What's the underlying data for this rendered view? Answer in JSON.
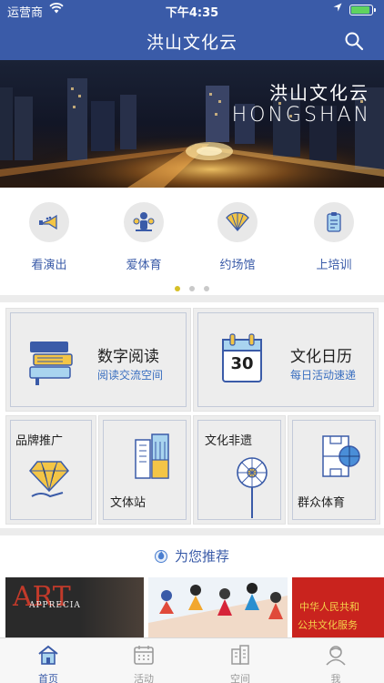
{
  "status_bar": {
    "carrier": "运营商",
    "time": "下午4:35"
  },
  "nav": {
    "title": "洪山文化云"
  },
  "banner": {
    "title_cn": "洪山文化云",
    "title_en": "HONGSHAN"
  },
  "quick_entries": [
    {
      "label": "看演出",
      "icon": "trumpet-icon"
    },
    {
      "label": "爱体育",
      "icon": "sports-icon"
    },
    {
      "label": "约场馆",
      "icon": "fan-icon"
    },
    {
      "label": "上培训",
      "icon": "clipboard-icon"
    }
  ],
  "pager": {
    "pages": 3,
    "active": 0
  },
  "features": {
    "reading": {
      "title": "数字阅读",
      "subtitle": "阅读交流空间"
    },
    "calendar": {
      "title": "文化日历",
      "subtitle": "每日活动速递",
      "day": "30"
    },
    "brand": {
      "title": "品牌推广"
    },
    "station": {
      "title": "文体站"
    },
    "heritage": {
      "title": "文化非遗"
    },
    "sports": {
      "title": "群众体育"
    }
  },
  "recommend": {
    "title": "为您推荐",
    "cards": [
      {
        "text_a": "ART",
        "text_b": "APPRECIATION"
      },
      {
        "text_a": ""
      },
      {
        "text_a": "中华人民共和",
        "text_b": "公共文化服务"
      }
    ]
  },
  "tabs": [
    {
      "label": "首页",
      "icon": "home-icon",
      "active": true
    },
    {
      "label": "活动",
      "icon": "calendar-icon",
      "active": false
    },
    {
      "label": "空间",
      "icon": "building-icon",
      "active": false
    },
    {
      "label": "我",
      "icon": "profile-icon",
      "active": false
    }
  ],
  "colors": {
    "brand": "#3a5ba8",
    "accent_blue": "#3a6fc0",
    "pager_active": "#d6c027"
  }
}
